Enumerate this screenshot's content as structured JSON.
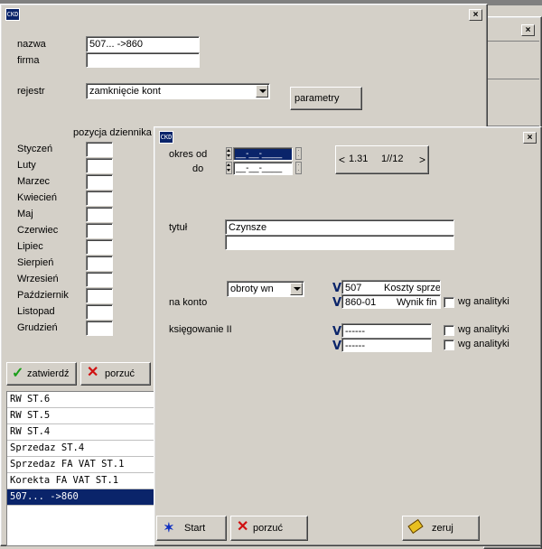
{
  "back_window": {
    "top_text": "...",
    "form": {
      "nazwa_label": "nazwa",
      "nazwa_value": "507... ->860",
      "firma_label": "firma",
      "firma_value": "",
      "rejestr_label": "rejestr",
      "rejestr_value": "zamknięcie kont",
      "parametry_label": "parametry",
      "pozycja_header": "pozycja dziennika",
      "months": [
        "Styczeń",
        "Luty",
        "Marzec",
        "Kwiecień",
        "Maj",
        "Czerwiec",
        "Lipiec",
        "Sierpień",
        "Wrzesień",
        "Październik",
        "Listopad",
        "Grudzień"
      ]
    },
    "buttons": {
      "confirm_label": "zatwierdź",
      "cancel_label": "porzuć"
    },
    "list_items": [
      "RW ST.6",
      "RW ST.5",
      "RW ST.4",
      "Sprzedaz ST.4",
      "Sprzedaz FA VAT ST.1",
      "Korekta FA VAT ST.1",
      "507... ->860"
    ],
    "list_selected_index": 6
  },
  "dialog": {
    "icon_text": "CKD",
    "okres_od_label": "okres od",
    "do_label": "do",
    "date_from": "__-__-____",
    "date_to": "__-__-____",
    "period_value": "1.31",
    "period_fraction": "1//12",
    "prev_symbol": "<",
    "next_symbol": ">",
    "tytul_label": "tytuł",
    "tytul_value": "Czynsze",
    "tytul_value2": "",
    "obroty_value": "obroty wn",
    "na_konto_label": "na konto",
    "accounts": [
      {
        "code": "507",
        "name": "Koszty sprze"
      },
      {
        "code": "860-01",
        "name": "Wynik fin"
      }
    ],
    "wg_analityki_label": "wg analityki",
    "ksiegowanie_label": "księgowanie II",
    "ksiegowanie_rows": [
      "------",
      "------"
    ],
    "v_symbol": "V",
    "start_label": "Start",
    "porzuc_label": "porzuć",
    "zeruj_label": "zeruj"
  },
  "colors": {
    "face": "#d4d0c8",
    "title_active": "#0a246a",
    "selection": "#0a246a",
    "check_green": "#1a9e1a",
    "cancel_red": "#d01010"
  }
}
